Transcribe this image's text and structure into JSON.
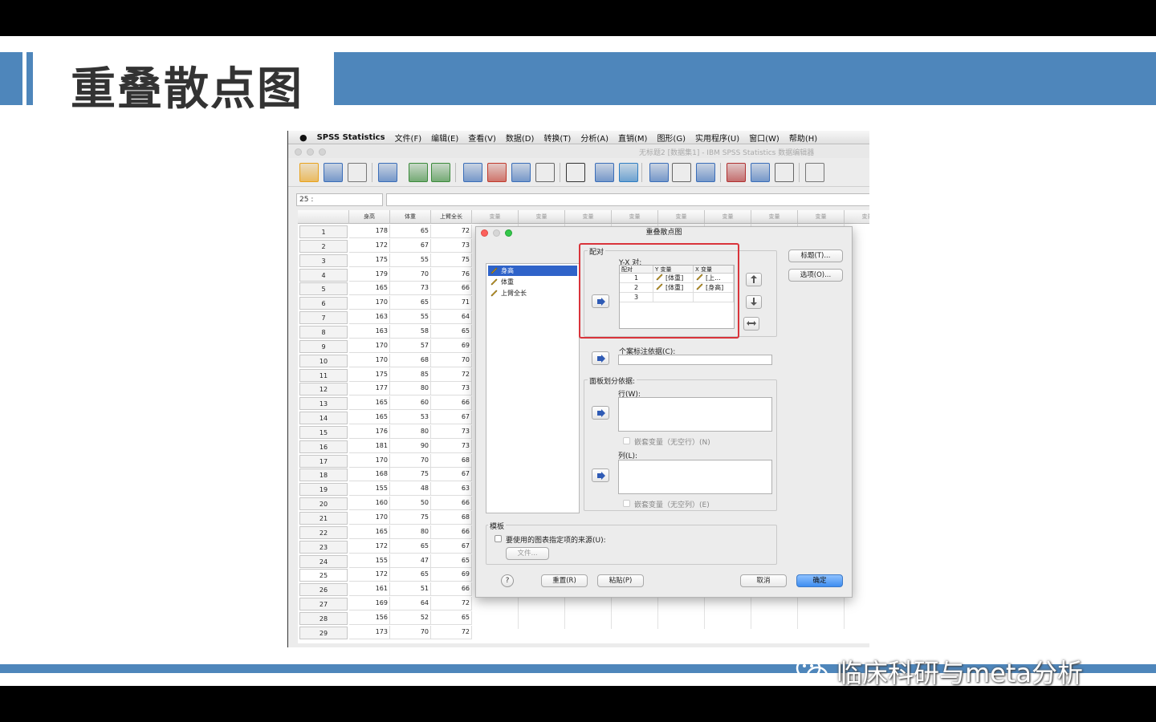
{
  "slide": {
    "title": "重叠散点图",
    "watermark": "临床科研与meta分析"
  },
  "menubar": {
    "app_name": "SPSS Statistics",
    "items": [
      "文件(F)",
      "编辑(E)",
      "查看(V)",
      "数据(D)",
      "转换(T)",
      "分析(A)",
      "直销(M)",
      "图形(G)",
      "实用程序(U)",
      "窗口(W)",
      "帮助(H)"
    ]
  },
  "window": {
    "title": "无标题2 [数据集1] - IBM SPSS Statistics 数据编辑器"
  },
  "toolbar": {
    "icons": [
      "open-folder-icon",
      "save-icon",
      "print-icon",
      "recall-dialog-icon",
      "undo-icon",
      "redo-icon",
      "goto-case-icon",
      "goto-variable-icon",
      "variables-icon",
      "split-cells-icon",
      "find-icon",
      "insert-cases-icon",
      "insert-variable-icon",
      "split-file-icon",
      "weight-cases-icon",
      "select-cases-icon",
      "value-labels-icon",
      "use-sets-icon",
      "show-all-icon",
      "spelling-icon"
    ]
  },
  "editor": {
    "cell_ref": "25 :",
    "columns": [
      "身高",
      "体重",
      "上臂全长"
    ],
    "empty_column_label": "变量",
    "rows": [
      [
        "1",
        "178",
        "65",
        "72"
      ],
      [
        "2",
        "172",
        "67",
        "73"
      ],
      [
        "3",
        "175",
        "55",
        "75"
      ],
      [
        "4",
        "179",
        "70",
        "76"
      ],
      [
        "5",
        "165",
        "73",
        "66"
      ],
      [
        "6",
        "170",
        "65",
        "71"
      ],
      [
        "7",
        "163",
        "55",
        "64"
      ],
      [
        "8",
        "163",
        "58",
        "65"
      ],
      [
        "9",
        "170",
        "57",
        "69"
      ],
      [
        "10",
        "170",
        "68",
        "70"
      ],
      [
        "11",
        "175",
        "85",
        "72"
      ],
      [
        "12",
        "177",
        "80",
        "73"
      ],
      [
        "13",
        "165",
        "60",
        "66"
      ],
      [
        "14",
        "165",
        "53",
        "67"
      ],
      [
        "15",
        "176",
        "80",
        "73"
      ],
      [
        "16",
        "181",
        "90",
        "73"
      ],
      [
        "17",
        "170",
        "70",
        "68"
      ],
      [
        "18",
        "168",
        "75",
        "67"
      ],
      [
        "19",
        "155",
        "48",
        "63"
      ],
      [
        "20",
        "160",
        "50",
        "66"
      ],
      [
        "21",
        "170",
        "75",
        "68"
      ],
      [
        "22",
        "165",
        "80",
        "66"
      ],
      [
        "23",
        "172",
        "65",
        "67"
      ],
      [
        "24",
        "155",
        "47",
        "65"
      ],
      [
        "25",
        "172",
        "65",
        "69"
      ],
      [
        "26",
        "161",
        "51",
        "66"
      ],
      [
        "27",
        "169",
        "64",
        "72"
      ],
      [
        "28",
        "156",
        "52",
        "65"
      ],
      [
        "29",
        "173",
        "70",
        "72"
      ]
    ]
  },
  "dialog": {
    "title": "重叠散点图",
    "variables": [
      "身高",
      "体重",
      "上臂全长"
    ],
    "pairs_group": "配对",
    "pairs_label": "Y-X 对:",
    "pairs_headers": [
      "配对",
      "Y 变量",
      "X 变量"
    ],
    "pairs": [
      {
        "n": "1",
        "y": "[体重]",
        "x": "[上..."
      },
      {
        "n": "2",
        "y": "[体重]",
        "x": "[身高]"
      },
      {
        "n": "3",
        "y": "",
        "x": ""
      }
    ],
    "case_label_field": "个案标注依据(C):",
    "panel_group": "面板划分依据:",
    "row_label": "行(W):",
    "nest_rows": "嵌套变量（无空行）(N)",
    "col_label": "列(L):",
    "nest_cols": "嵌套变量（无空列）(E)",
    "template_group": "模板",
    "template_check": "要使用的图表指定项的来源(U):",
    "file_button": "文件...",
    "titles_button": "标题(T)...",
    "options_button": "选项(O)...",
    "help": "?",
    "reset": "重置(R)",
    "paste": "粘贴(P)",
    "cancel": "取消",
    "ok": "确定"
  }
}
